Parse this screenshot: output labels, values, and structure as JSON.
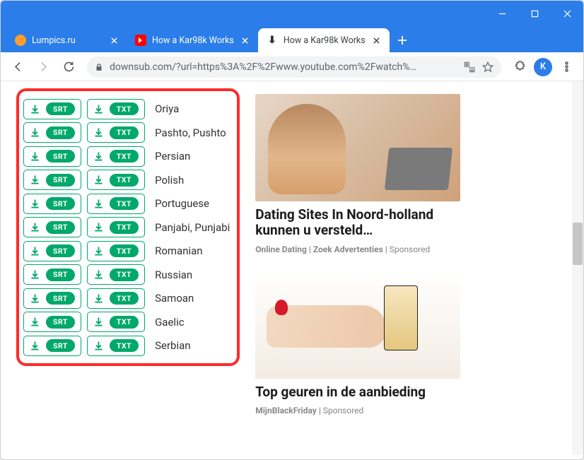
{
  "window_controls": {
    "minimize": "min",
    "maximize": "max",
    "close": "close"
  },
  "tabs": [
    {
      "label": "Lumpics.ru",
      "icon": "orange"
    },
    {
      "label": "How a Kar98k Works",
      "icon": "yt"
    },
    {
      "label": "How a Kar98k Works",
      "icon": "ds",
      "active": true
    }
  ],
  "toolbar": {
    "url": "downsub.com/?url=https%3A%2F%2Fwww.youtube.com%2Fwatch%…",
    "profile_letter": "K"
  },
  "buttons": {
    "srt": "SRT",
    "txt": "TXT"
  },
  "languages": [
    "Oriya",
    "Pashto, Pushto",
    "Persian",
    "Polish",
    "Portuguese",
    "Panjabi, Punjabi",
    "Romanian",
    "Russian",
    "Samoan",
    "Gaelic",
    "Serbian"
  ],
  "ads": [
    {
      "title": "Dating Sites In Noord-holland kunnen u versteld…",
      "source": "Online Dating",
      "extra": "Zoek Advertenties",
      "sponsored": "Sponsored"
    },
    {
      "title": "Top geuren in de aanbieding",
      "source": "MijnBlackFriday",
      "extra": "",
      "sponsored": "Sponsored"
    }
  ]
}
